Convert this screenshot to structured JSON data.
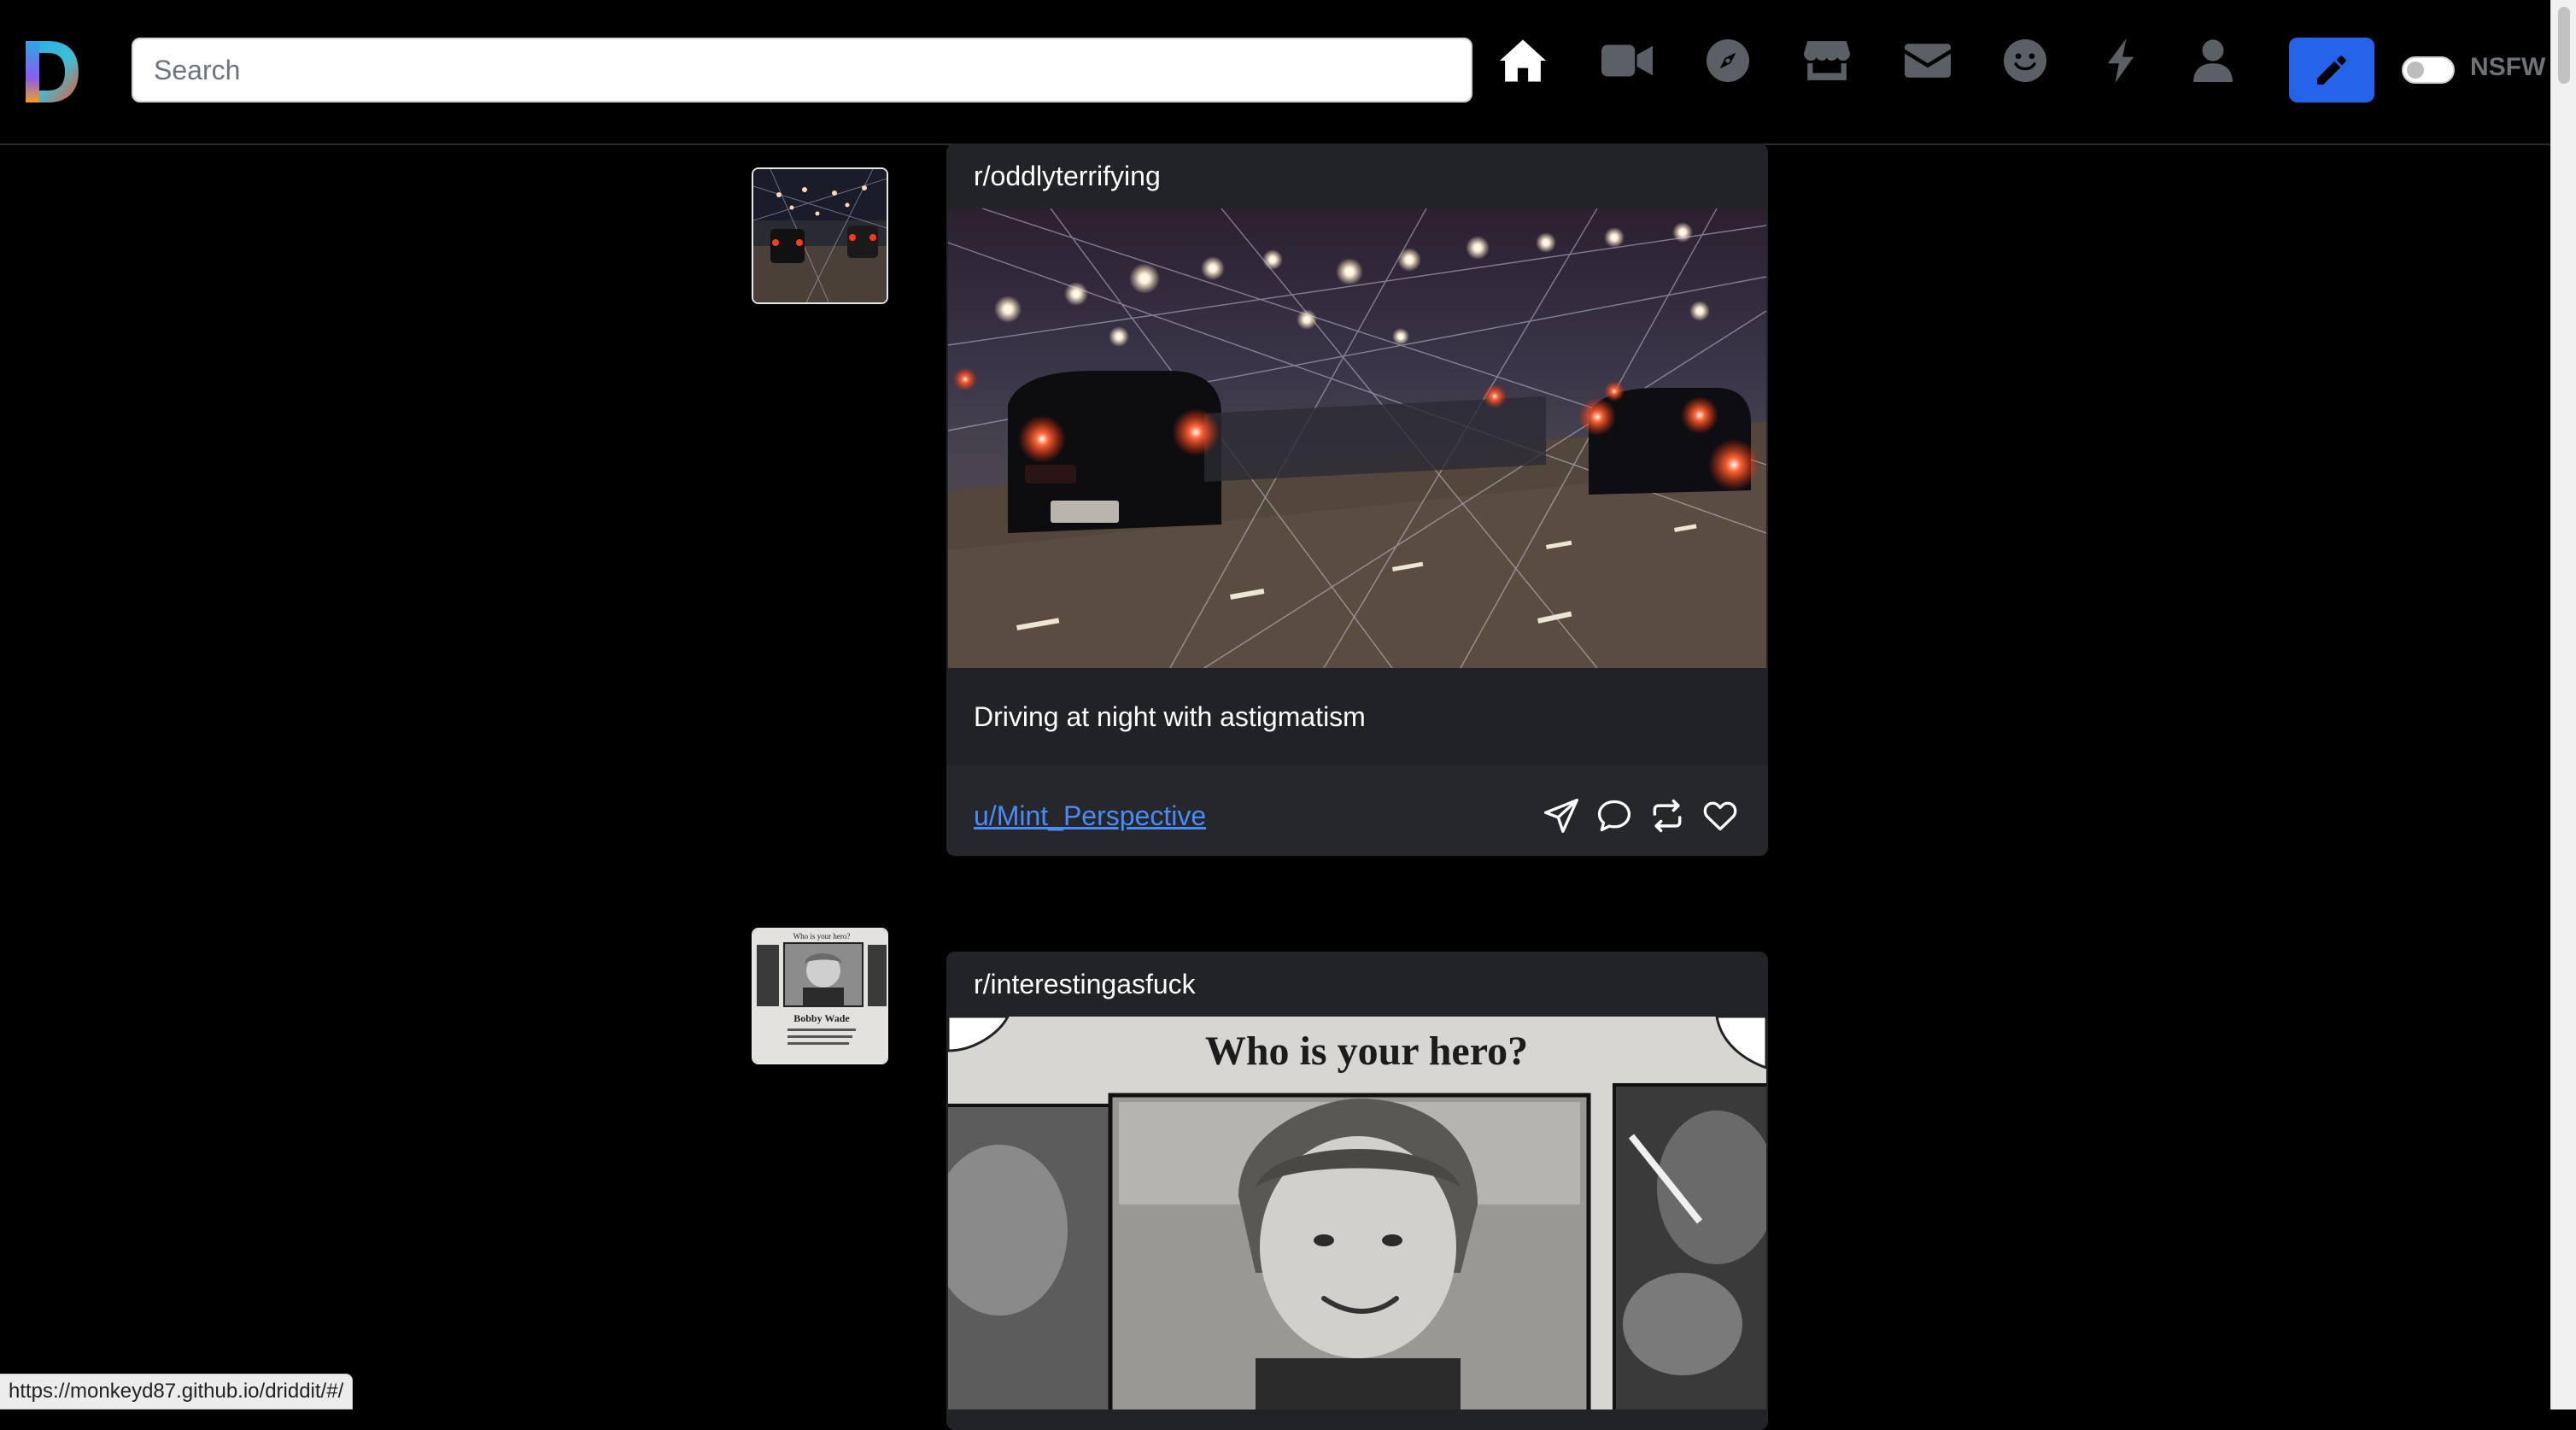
{
  "header": {
    "logo_letter": "D",
    "search": {
      "placeholder": "Search",
      "value": ""
    },
    "nav_icons": [
      "home-icon",
      "video-icon",
      "compass-icon",
      "store-icon",
      "mail-icon",
      "smile-icon",
      "bolt-icon",
      "user-icon"
    ],
    "nsfw_label": "NSFW",
    "nsfw_enabled": false
  },
  "feed": {
    "posts": [
      {
        "subreddit": "r/oddlyterrifying",
        "title": "Driving at night with astigmatism",
        "author": "u/Mint_Perspective",
        "image_desc": "night traffic with starburst lights"
      },
      {
        "subreddit": "r/interestingasfuck",
        "title": "",
        "author": "",
        "image_text": "Who is your hero?",
        "thumb_caption": "Bobby Wade"
      }
    ]
  },
  "status_bar": {
    "url": "https://monkeyd87.github.io/driddit/#/"
  },
  "colors": {
    "accent": "#2563eb",
    "link": "#4a8cf7",
    "card_bg": "#212327",
    "page_bg": "#000000",
    "icon_dim": "#5b5f66"
  }
}
